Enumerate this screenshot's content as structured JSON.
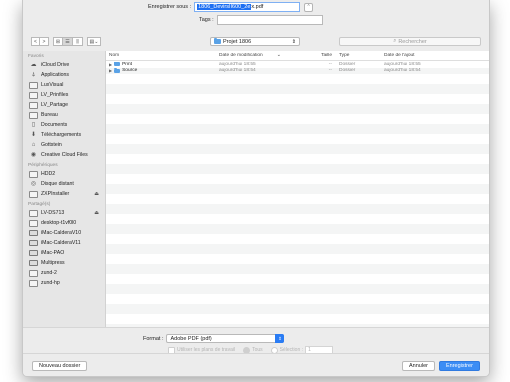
{
  "save": {
    "label": "Enregistrer sous :",
    "filename_selected": "1806_DevirsII600_2e",
    "filename_rest": "x.pdf"
  },
  "tags": {
    "label": "Tags :"
  },
  "toolbar": {
    "back": "<",
    "forward": ">",
    "location": "Projet 1806",
    "search_placeholder": "Rechercher"
  },
  "sidebar": {
    "sections": [
      {
        "title": "Favoris",
        "items": [
          {
            "label": "iCloud Drive",
            "icon": "cloud-icon"
          },
          {
            "label": "Applications",
            "icon": "applications-icon"
          },
          {
            "label": "LuxVisual",
            "icon": "folder-icon"
          },
          {
            "label": "LV_Prinfiles",
            "icon": "folder-icon"
          },
          {
            "label": "LV_Partage",
            "icon": "folder-icon"
          },
          {
            "label": "Bureau",
            "icon": "folder-icon"
          },
          {
            "label": "Documents",
            "icon": "documents-icon"
          },
          {
            "label": "Téléchargements",
            "icon": "downloads-icon"
          },
          {
            "label": "Gottstein",
            "icon": "home-icon"
          },
          {
            "label": "Creative Cloud Files",
            "icon": "creative-cloud-icon"
          }
        ]
      },
      {
        "title": "Périphériques",
        "items": [
          {
            "label": "HDD2",
            "icon": "disk-icon"
          },
          {
            "label": "Disque distant",
            "icon": "remote-disk-icon"
          },
          {
            "label": "ZXPInstaller",
            "icon": "disk-icon",
            "eject": "⏏"
          }
        ]
      },
      {
        "title": "Partagé(s)",
        "items": [
          {
            "label": "LV-DS713",
            "icon": "server-icon",
            "eject": "⏏"
          },
          {
            "label": "desktop-t1vf0l0",
            "icon": "server-icon"
          },
          {
            "label": "iMac-CalderaV10",
            "icon": "monitor-icon"
          },
          {
            "label": "iMac-CalderaV11",
            "icon": "monitor-icon"
          },
          {
            "label": "iMac-PAO",
            "icon": "monitor-icon"
          },
          {
            "label": "Multipress",
            "icon": "monitor-icon"
          },
          {
            "label": "zund-2",
            "icon": "server-icon"
          },
          {
            "label": "zund-hp",
            "icon": "server-icon"
          }
        ]
      }
    ]
  },
  "columns": {
    "name": "Nom",
    "modified": "Date de modification",
    "sort": "⌄",
    "size": "Taille",
    "type": "Type",
    "added": "Date de l'ajout"
  },
  "files": [
    {
      "name": "Print",
      "modified": "aujourd'hui 18:55",
      "size": "--",
      "type": "Dossier",
      "added": "aujourd'hui 18:55"
    },
    {
      "name": "Source",
      "modified": "aujourd'hui 18:54",
      "size": "--",
      "type": "Dossier",
      "added": "aujourd'hui 18:54"
    }
  ],
  "format": {
    "label": "Format :",
    "value": "Adobe PDF (pdf)",
    "option_layers": "Utiliser les plans de travail",
    "option_all": "Tous",
    "option_selection": "Sélection :",
    "selection_value": "1"
  },
  "buttons": {
    "new_folder": "Nouveau dossier",
    "cancel": "Annuler",
    "save": "Enregistrer"
  },
  "colors": {
    "accent": "#3b8df5",
    "folder": "#5aa2e6"
  }
}
